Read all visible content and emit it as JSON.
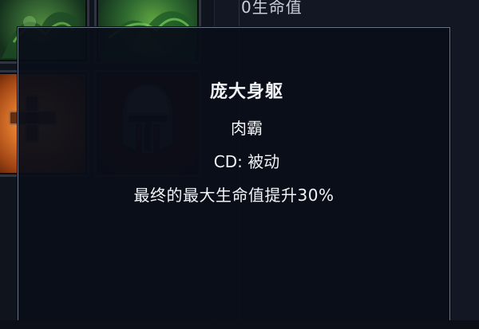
{
  "background_panel": {
    "top_text": "0生命值"
  },
  "slots": {
    "top_left": {
      "icon": "foliage-icon"
    },
    "top_right": {
      "icon": "foliage-icon"
    },
    "mid_left": {
      "icon": "plus-icon"
    },
    "mid_right": {
      "icon": "spartan-helmet-icon"
    }
  },
  "tooltip": {
    "title": "庞大身躯",
    "type": "肉霸",
    "cooldown": "CD: 被动",
    "description": "最终的最大生命值提升30%"
  },
  "colors": {
    "tooltip_border": "#6b7587",
    "tooltip_bg": "#0a0e18",
    "text": "#f2f4f7"
  }
}
